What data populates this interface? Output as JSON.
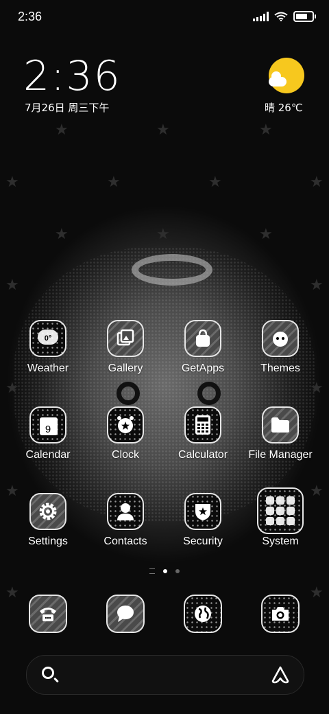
{
  "status": {
    "time": "2:36",
    "battery_level": 0.9
  },
  "widget": {
    "time": "2:36",
    "date": "7月26日 周三下午",
    "weather": "晴 26℃",
    "weather_icon": "sun-with-cloud-icon"
  },
  "apps": [
    {
      "label": "Weather",
      "icon": "weather-icon",
      "glyph": "0°"
    },
    {
      "label": "Gallery",
      "icon": "gallery-icon"
    },
    {
      "label": "GetApps",
      "icon": "shopping-bag-icon"
    },
    {
      "label": "Themes",
      "icon": "themes-icon"
    },
    {
      "label": "Calendar",
      "icon": "calendar-icon",
      "glyph": "9"
    },
    {
      "label": "Clock",
      "icon": "clock-icon"
    },
    {
      "label": "Calculator",
      "icon": "calculator-icon"
    },
    {
      "label": "File Manager",
      "icon": "folder-icon"
    },
    {
      "label": "Settings",
      "icon": "gear-icon"
    },
    {
      "label": "Contacts",
      "icon": "contacts-icon"
    },
    {
      "label": "Security",
      "icon": "shield-icon"
    },
    {
      "label": "System",
      "icon": "folder-grid-icon"
    }
  ],
  "dock": [
    {
      "icon": "phone-icon"
    },
    {
      "icon": "messages-icon"
    },
    {
      "icon": "browser-icon"
    },
    {
      "icon": "camera-icon"
    }
  ],
  "pager": {
    "pages": 2,
    "active": 1
  },
  "search": {
    "left_icon": "search-icon",
    "right_icon": "assistant-logo-icon"
  }
}
